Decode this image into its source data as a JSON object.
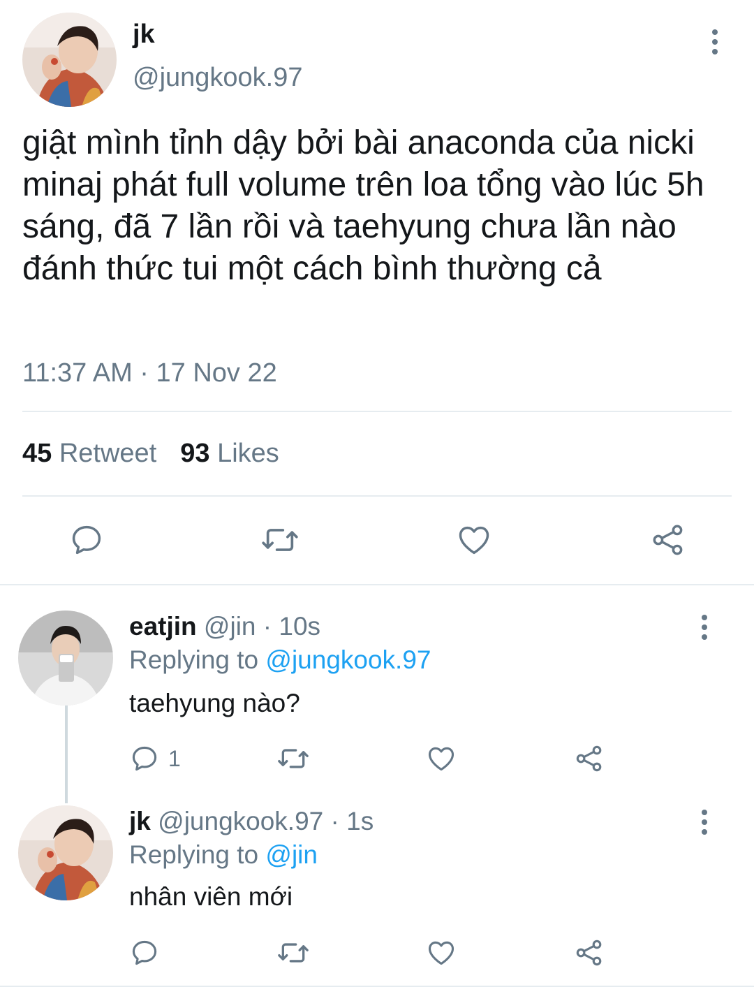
{
  "tweet": {
    "author_name": "jk",
    "author_handle": "@jungkook.97",
    "text": "giật mình tỉnh dậy bởi bài anaconda của nicki minaj phát full volume trên loa tổng vào lúc 5h sáng, đã 7 lần rồi và taehyung chưa lần nào đánh thức tui một cách bình thường cả",
    "timestamp": "11:37 AM · 17 Nov 22",
    "retweet_count": "45",
    "retweet_label": "Retweet",
    "like_count": "93",
    "like_label": "Likes"
  },
  "replies": [
    {
      "name": "eatjin",
      "meta": "@jin · 10s",
      "replying_prefix": "Replying to",
      "replying_to": "@jungkook.97",
      "text": "taehyung nào?",
      "reply_count": "1"
    },
    {
      "name": "jk",
      "meta": "@jungkook.97 · 1s",
      "replying_prefix": "Replying to",
      "replying_to": "@jin",
      "text": "nhân viên mới",
      "reply_count": ""
    }
  ],
  "colors": {
    "text": "#14171a",
    "secondary": "#657786",
    "link": "#1da1f2",
    "divider": "#e6ecf0"
  },
  "icons": [
    "kebab-menu-icon",
    "reply-icon",
    "retweet-icon",
    "like-icon",
    "share-icon"
  ]
}
